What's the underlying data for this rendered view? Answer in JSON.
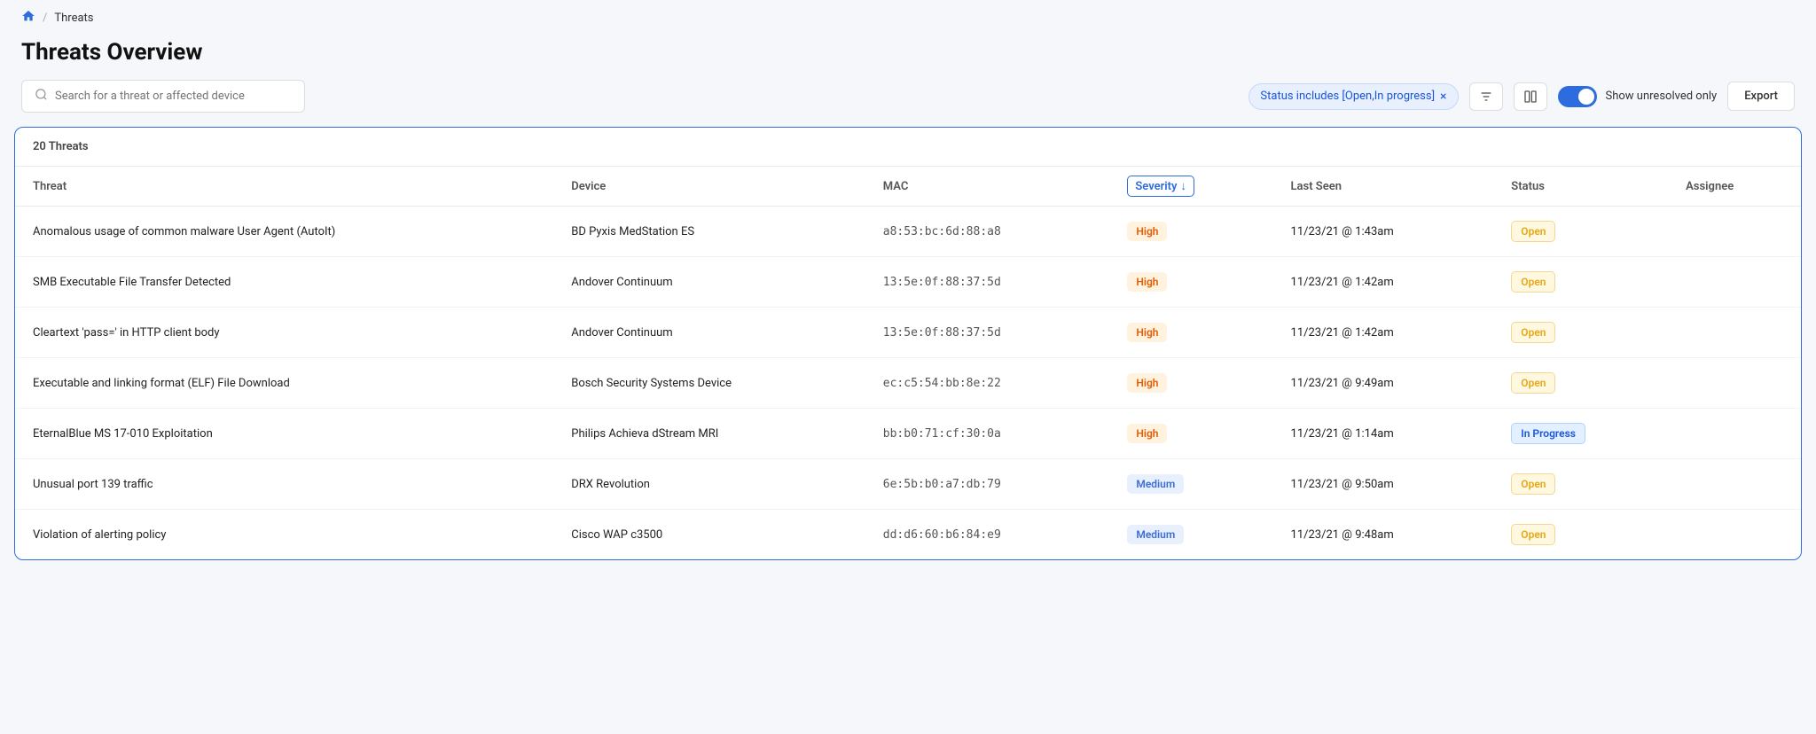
{
  "breadcrumb": {
    "home_label": "🏠",
    "separator": "/",
    "current": "Threats"
  },
  "page": {
    "title": "Threats Overview"
  },
  "toolbar": {
    "search_placeholder": "Search for a threat or affected device",
    "filter_chip": "Status includes [Open,In progress]",
    "filter_icon": "×",
    "show_unresolved_label": "Show unresolved only",
    "export_label": "Export"
  },
  "table": {
    "count_label": "20 Threats",
    "columns": {
      "threat": "Threat",
      "device": "Device",
      "mac": "MAC",
      "severity": "Severity",
      "last_seen": "Last Seen",
      "status": "Status",
      "assignee": "Assignee"
    },
    "rows": [
      {
        "threat": "Anomalous usage of common malware User Agent (AutoIt)",
        "device": "BD Pyxis MedStation ES",
        "mac": "a8:53:bc:6d:88:a8",
        "severity": "High",
        "severity_type": "high",
        "last_seen": "11/23/21 @ 1:43am",
        "status": "Open",
        "status_type": "open",
        "assignee": ""
      },
      {
        "threat": "SMB Executable File Transfer Detected",
        "device": "Andover Continuum",
        "mac": "13:5e:0f:88:37:5d",
        "severity": "High",
        "severity_type": "high",
        "last_seen": "11/23/21 @ 1:42am",
        "status": "Open",
        "status_type": "open",
        "assignee": ""
      },
      {
        "threat": "Cleartext 'pass=' in HTTP client body",
        "device": "Andover Continuum",
        "mac": "13:5e:0f:88:37:5d",
        "severity": "High",
        "severity_type": "high",
        "last_seen": "11/23/21 @ 1:42am",
        "status": "Open",
        "status_type": "open",
        "assignee": ""
      },
      {
        "threat": "Executable and linking format (ELF) File Download",
        "device": "Bosch Security Systems Device",
        "mac": "ec:c5:54:bb:8e:22",
        "severity": "High",
        "severity_type": "high",
        "last_seen": "11/23/21 @ 9:49am",
        "status": "Open",
        "status_type": "open",
        "assignee": ""
      },
      {
        "threat": "EternalBlue MS 17-010 Exploitation",
        "device": "Philips Achieva dStream MRI",
        "mac": "bb:b0:71:cf:30:0a",
        "severity": "High",
        "severity_type": "high",
        "last_seen": "11/23/21 @ 1:14am",
        "status": "In Progress",
        "status_type": "in-progress",
        "assignee": ""
      },
      {
        "threat": "Unusual port 139 traffic",
        "device": "DRX Revolution",
        "mac": "6e:5b:b0:a7:db:79",
        "severity": "Medium",
        "severity_type": "medium",
        "last_seen": "11/23/21 @ 9:50am",
        "status": "Open",
        "status_type": "open",
        "assignee": ""
      },
      {
        "threat": "Violation of alerting policy",
        "device": "Cisco WAP c3500",
        "mac": "dd:d6:60:b6:84:e9",
        "severity": "Medium",
        "severity_type": "medium",
        "last_seen": "11/23/21 @ 9:48am",
        "status": "Open",
        "status_type": "open",
        "assignee": ""
      }
    ]
  }
}
